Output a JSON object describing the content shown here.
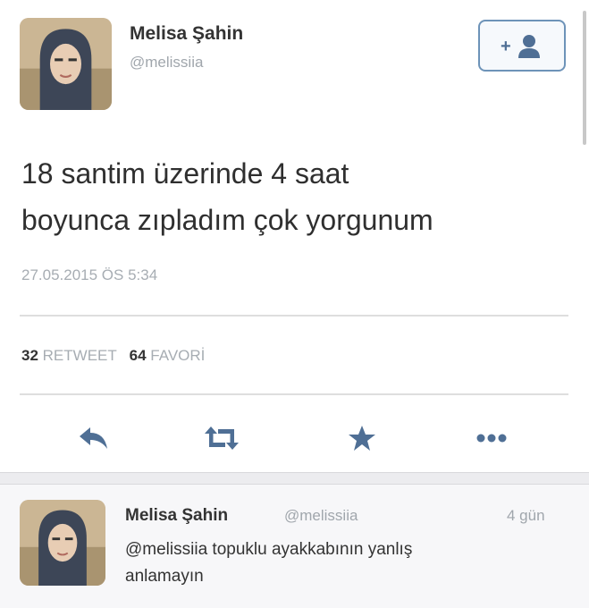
{
  "tweet": {
    "author_name": "Melisa Şahin",
    "author_handle": "@melissiia",
    "text_line1": "18 santim üzerinde 4 saat",
    "text_line2": "boyunca zıpladım çok yorgunum",
    "timestamp": "27.05.2015 ÖS 5:34",
    "retweet_count": "32",
    "retweet_label": "RETWEET",
    "favorite_count": "64",
    "favorite_label": "FAVORİ",
    "actions": [
      "reply-icon",
      "retweet-icon",
      "favorite-star-icon",
      "more-icon"
    ],
    "follow_icon": "add-user-icon"
  },
  "reply": {
    "author_name": "Melisa Şahin",
    "author_handle": "@melissiia",
    "time": "4 gün",
    "text_line1": "@melissiia topuklu ayakkabının yanlış",
    "text_line2": "anlamayın"
  },
  "colors": {
    "accent": "#6d93b8",
    "icon": "#4f6f95",
    "muted": "#a7adb3"
  }
}
